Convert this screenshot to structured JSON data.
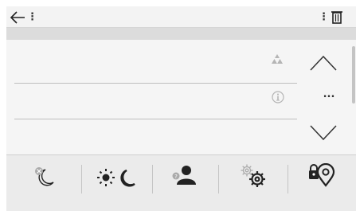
{
  "topbar": {
    "back_icon": "arrow-left-icon",
    "left_menu_label": "⋮",
    "right_menu_label": "⋮",
    "trash_icon": "trash-icon"
  },
  "list": {
    "rows": [
      {
        "icon": "warning-triangles-icon"
      },
      {
        "icon": "info-circle-icon"
      },
      {
        "icon": ""
      }
    ]
  },
  "side": {
    "up_icon": "chevron-up-icon",
    "more_label": "...",
    "down_icon": "chevron-down-icon"
  },
  "bottombar": {
    "buttons": [
      {
        "icon": "night-mode-off-icon"
      },
      {
        "icon": "day-night-icon"
      },
      {
        "icon": "user-question-icon"
      },
      {
        "icon": "settings-gears-icon"
      },
      {
        "icon": "privacy-lock-pin-icon"
      }
    ]
  },
  "colors": {
    "icon_dark": "#222222",
    "icon_gray": "#aaaaaa",
    "divider": "#bdbdbd"
  }
}
